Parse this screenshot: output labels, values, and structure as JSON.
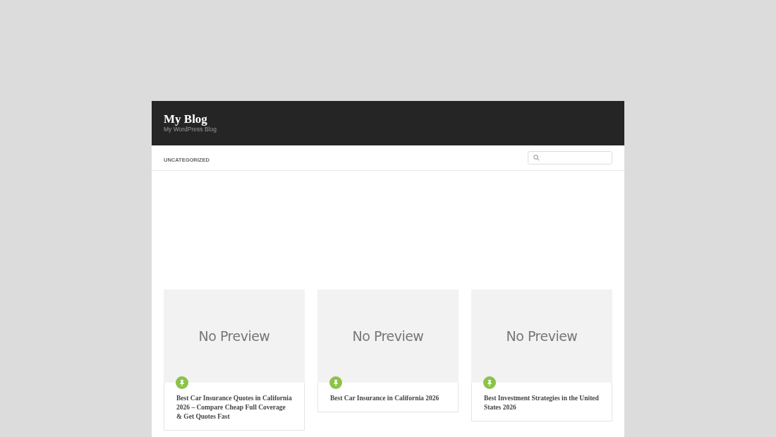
{
  "site": {
    "title": "My Blog",
    "tagline": "My WordPress Blog"
  },
  "nav": {
    "items": [
      {
        "label": "UNCATEGORIZED"
      }
    ]
  },
  "posts": [
    {
      "preview": "No Preview",
      "sticky": true,
      "title": "Best Car Insurance Quotes in California 2026 – Compare Cheap Full Coverage & Get Quotes Fast"
    },
    {
      "preview": "No Preview",
      "sticky": true,
      "title": "Best Car Insurance in California 2026"
    },
    {
      "preview": "No Preview",
      "sticky": true,
      "title": "Best Investment Strategies in the United States 2026"
    }
  ]
}
